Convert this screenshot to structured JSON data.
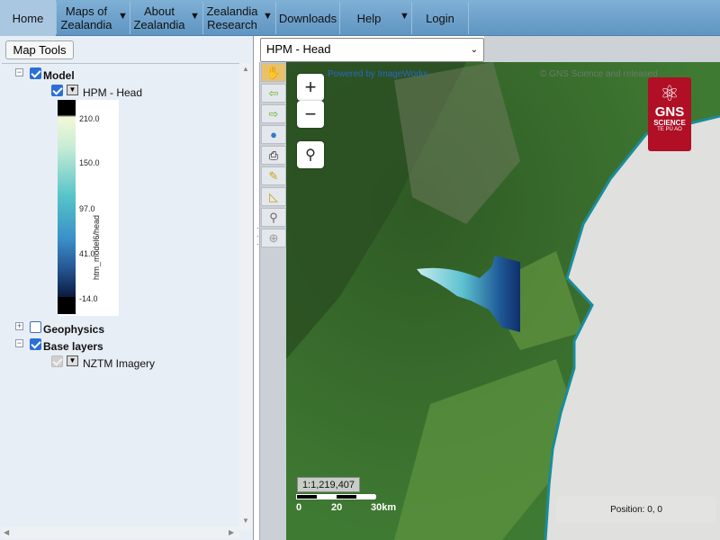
{
  "nav": {
    "items": [
      {
        "label": "Home"
      },
      {
        "label": "Maps of Zealandia",
        "has_dropdown": true
      },
      {
        "label": "About Zealandia",
        "has_dropdown": true
      },
      {
        "label": "Zealandia Research",
        "has_dropdown": true
      },
      {
        "label": "Downloads"
      },
      {
        "label": "Help",
        "has_dropdown": true
      },
      {
        "label": "Login"
      }
    ]
  },
  "left_panel": {
    "map_tools_button": "Map Tools",
    "tree": {
      "model": {
        "label": "Model",
        "checked": true
      },
      "hpm_head": {
        "label": "HPM - Head",
        "checked": true
      },
      "geophysics": {
        "label": "Geophysics",
        "checked": false
      },
      "base_layers": {
        "label": "Base layers",
        "checked": true
      },
      "nztm_imagery": {
        "label": "NZTM Imagery",
        "checked": true,
        "disabled": true
      }
    },
    "legend": {
      "title": "htm_model6/head",
      "ticks": [
        "210.0",
        "150.0",
        "97.0",
        "41.0",
        "-14.0"
      ]
    }
  },
  "map": {
    "layer_select": {
      "selected": "HPM - Head"
    },
    "zoom_in": "+",
    "zoom_out": "−",
    "scale_ratio": "1:1,219,407",
    "scale_labels": [
      "0",
      "20",
      "30km"
    ],
    "position": "Position: 0, 0",
    "powered_by": "Powered by ImageWorks",
    "attribution": "© GNS Science and released"
  },
  "logo": {
    "line1": "GNS",
    "line2": "SCIENCE",
    "line3": "TE PŪ AO"
  },
  "icons": [
    "pan-hand-icon",
    "back-arrow-icon",
    "forward-arrow-icon",
    "globe-icon",
    "print-icon",
    "measure-icon",
    "area-measure-icon",
    "settings-wrench-icon",
    "crosshair-icon",
    "search-magnifier-icon"
  ],
  "colors": {
    "nav_bg": "#6fa3cf",
    "home_bg": "#a9c7e0",
    "logo_red": "#b00f25",
    "sea": "#e0e0df"
  }
}
